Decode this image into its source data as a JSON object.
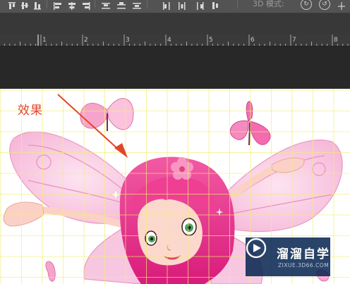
{
  "options_bar": {
    "mode_label": "3D 模式:",
    "align_icons": [
      "align-top-edges-icon",
      "align-vertical-centers-icon",
      "align-bottom-edges-icon",
      "align-left-edges-icon",
      "align-horizontal-centers-icon",
      "align-right-edges-icon"
    ],
    "distribute_icons": [
      "distribute-top-icon",
      "distribute-vcenter-icon",
      "distribute-bottom-icon",
      "distribute-left-icon",
      "distribute-hcenter-icon",
      "distribute-right-icon"
    ]
  },
  "ruler": {
    "labels": [
      "1",
      "2",
      "3",
      "4",
      "5",
      "6",
      "7",
      "8"
    ]
  },
  "canvas": {
    "annotation_text": "效果",
    "guide_color": "#f2ee70",
    "annotation_color": "#e2462a"
  },
  "watermark": {
    "title": "溜溜自学",
    "url": "ZIXUE.3D66.COM"
  },
  "colors": {
    "workspace": "#282828",
    "options_bar": "#535353",
    "ruler": "#3a3a3a",
    "watermark_bg": "#062450"
  }
}
